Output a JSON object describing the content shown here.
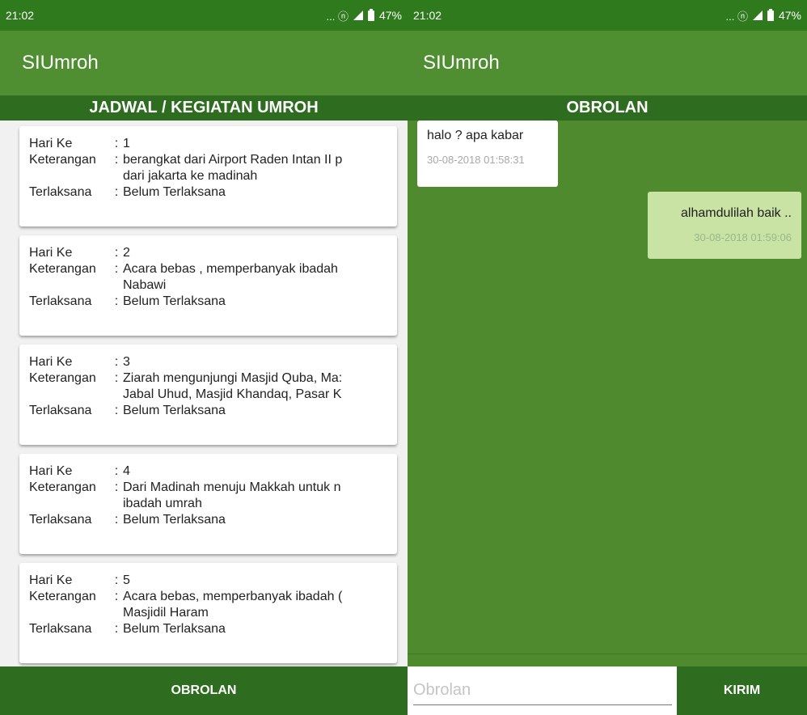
{
  "left": {
    "status": {
      "time": "21:02",
      "icons_text": "... ⓝ",
      "battery": "47%"
    },
    "app_title": "SIUmroh",
    "section_title": "JADWAL / KEGIATAN UMROH",
    "labels": {
      "day": "Hari Ke",
      "desc": "Keterangan",
      "done": "Terlaksana",
      "sep": ":"
    },
    "cards": [
      {
        "day": "1",
        "desc": "berangkat dari Airport Raden Intan II p",
        "desc2": "dari jakarta ke madinah",
        "done": "Belum Terlaksana"
      },
      {
        "day": "2",
        "desc": "Acara bebas , memperbanyak ibadah",
        "desc2": "Nabawi",
        "done": "Belum Terlaksana"
      },
      {
        "day": "3",
        "desc": "Ziarah mengunjungi Masjid Quba, Ma:",
        "desc2": "Jabal Uhud, Masjid Khandaq, Pasar K",
        "done": "Belum Terlaksana"
      },
      {
        "day": "4",
        "desc": "Dari Madinah menuju Makkah untuk n",
        "desc2": "ibadah umrah",
        "done": "Belum Terlaksana"
      },
      {
        "day": "5",
        "desc": "Acara bebas, memperbanyak ibadah (",
        "desc2": "Masjidil Haram",
        "done": "Belum Terlaksana"
      }
    ],
    "bottom_button": "OBROLAN"
  },
  "right": {
    "status": {
      "time": "21:02",
      "icons_text": "... ⓝ",
      "battery": "47%"
    },
    "app_title": "SIUmroh",
    "section_title": "OBROLAN",
    "messages": [
      {
        "text": "halo ? apa kabar",
        "time": "30-08-2018 01:58:31",
        "side": "left"
      },
      {
        "text": "alhamdulilah baik ..",
        "time": "30-08-2018 01:59:06",
        "side": "right"
      }
    ],
    "input": {
      "placeholder": "Obrolan",
      "value": ""
    },
    "send_button": "KIRIM"
  },
  "colors": {
    "status_bar": "#2f7a1c",
    "app_bar": "#4f8f32",
    "header": "#2e6c1f",
    "chat_bg": "#4f8a2f",
    "my_bubble": "#c8e3a3"
  }
}
